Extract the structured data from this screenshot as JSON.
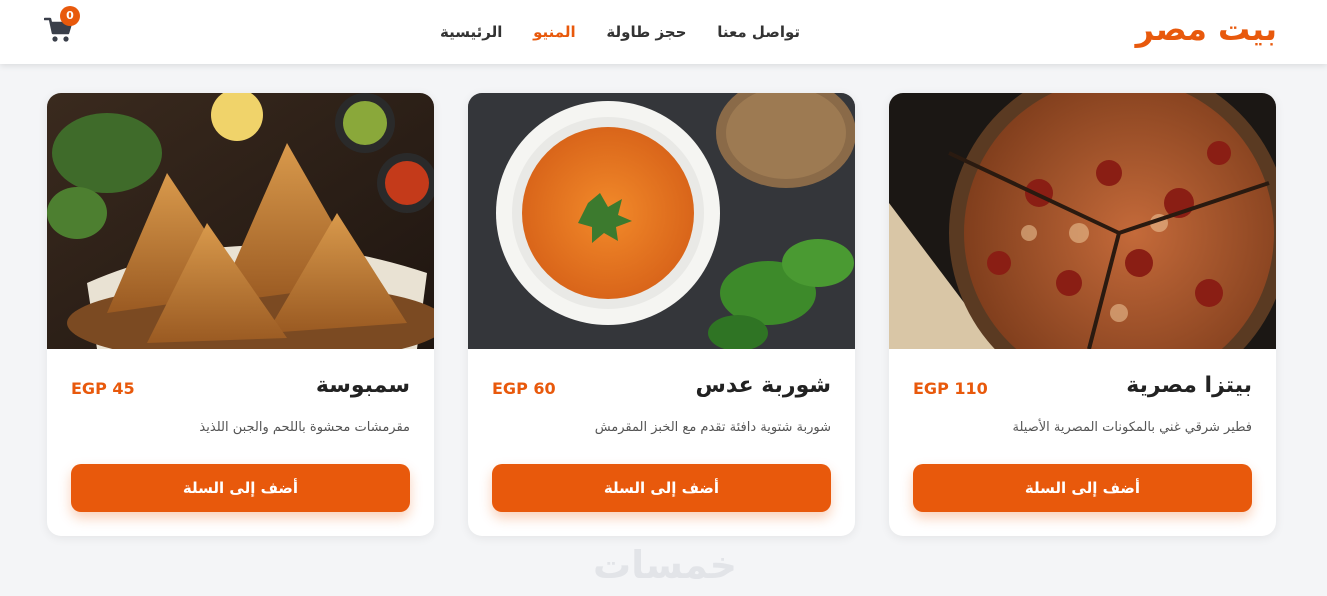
{
  "header": {
    "brand": "بيت مصر",
    "nav": [
      {
        "label": "الرئيسية",
        "active": false
      },
      {
        "label": "المنيو",
        "active": true
      },
      {
        "label": "حجز طاولة",
        "active": false
      },
      {
        "label": "تواصل معنا",
        "active": false
      }
    ],
    "cart": {
      "count": "0",
      "icon": "cart-icon"
    }
  },
  "menu": {
    "items": [
      {
        "name": "بيتزا مصرية",
        "price": "EGP 110",
        "description": "فطير شرقي غني بالمكونات المصرية الأصيلة",
        "button": "أضف إلى السلة",
        "image": "pizza-image"
      },
      {
        "name": "شوربة عدس",
        "price": "EGP 60",
        "description": "شوربة شتوية دافئة تقدم مع الخبز المقرمش",
        "button": "أضف إلى السلة",
        "image": "lentil-soup-image"
      },
      {
        "name": "سمبوسة",
        "price": "EGP 45",
        "description": "مقرمشات محشوة باللحم والجبن اللذيذ",
        "button": "أضف إلى السلة",
        "image": "sambousa-image"
      }
    ]
  },
  "watermark": "خمسات",
  "colors": {
    "accent": "#e8590c",
    "background": "#f4f5f7",
    "card": "#ffffff"
  }
}
